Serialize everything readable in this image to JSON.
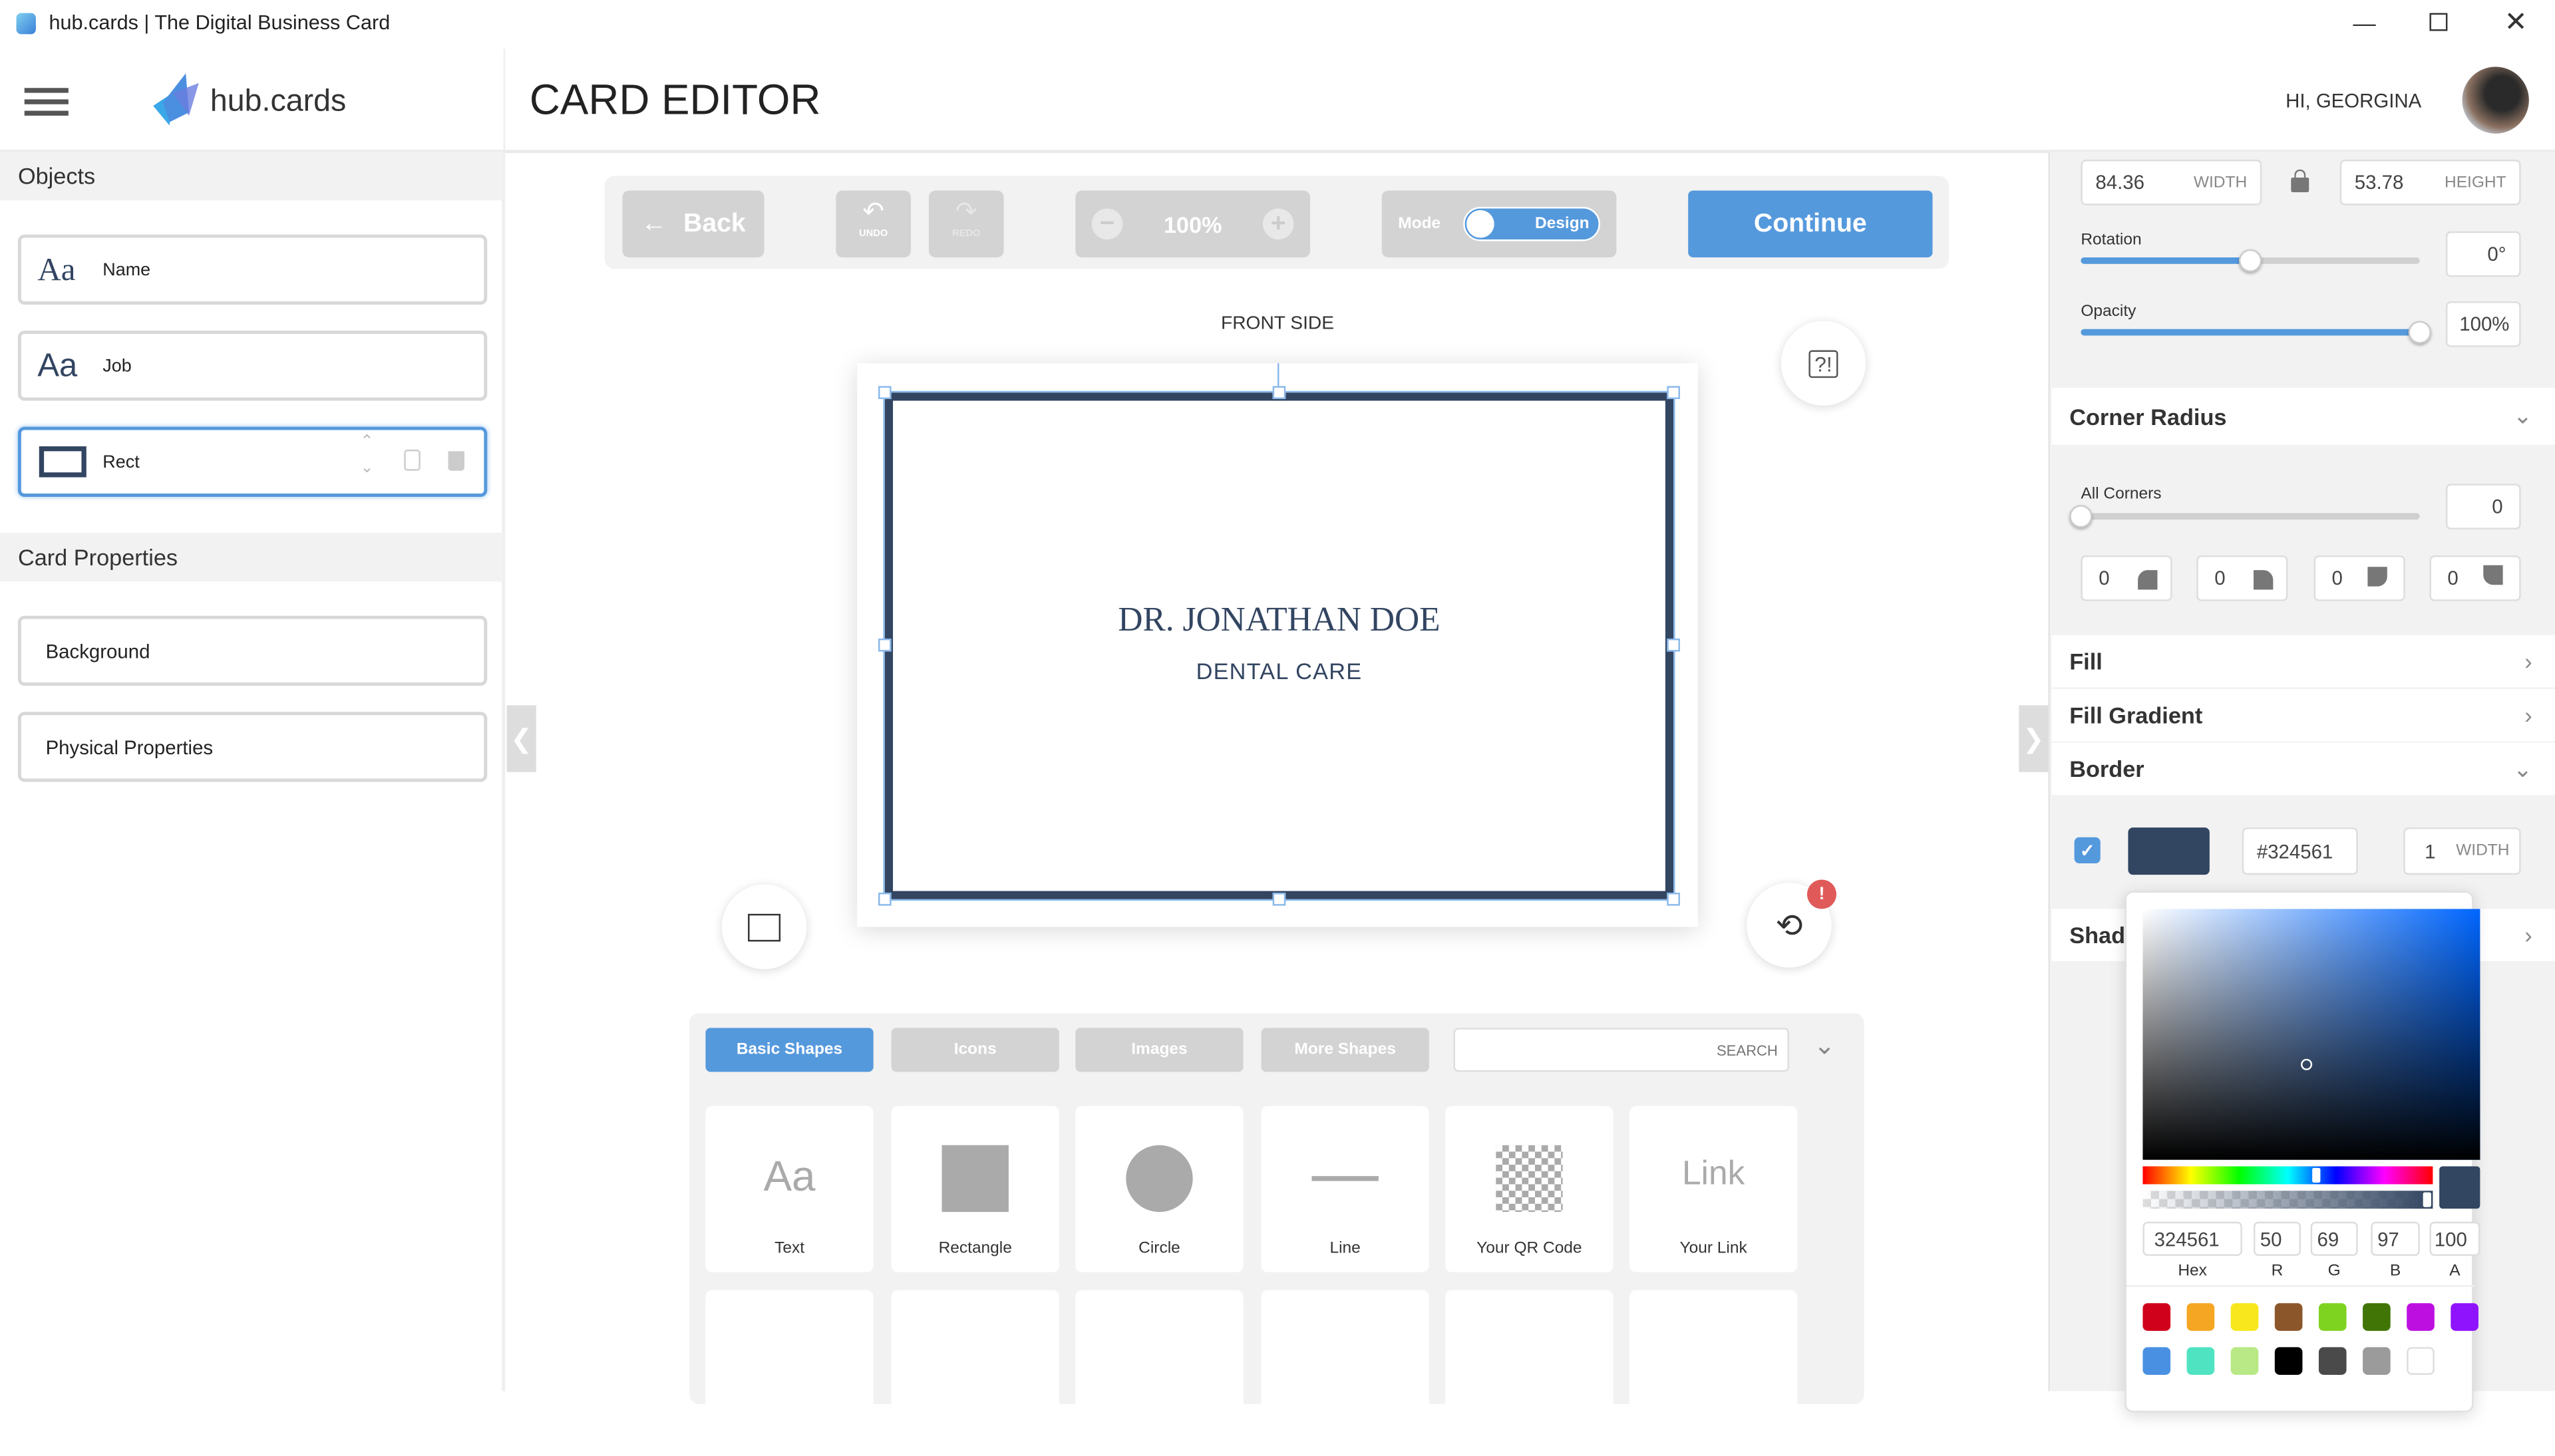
{
  "window": {
    "title": "hub.cards | The Digital Business Card"
  },
  "header": {
    "brand": "hub.cards",
    "page_title": "CARD EDITOR",
    "greeting": "HI, GEORGINA"
  },
  "left": {
    "objects_title": "Objects",
    "objects": [
      {
        "label": "Name",
        "icon": "Aa"
      },
      {
        "label": "Job",
        "icon": "Aa"
      },
      {
        "label": "Rect",
        "icon": "rect"
      }
    ],
    "card_properties_title": "Card Properties",
    "card_properties": [
      "Background",
      "Physical Properties"
    ]
  },
  "toolbar": {
    "back": "Back",
    "undo": "UNDO",
    "redo": "REDO",
    "zoom": "100%",
    "mode_label": "Mode",
    "mode_value": "Design",
    "continue": "Continue"
  },
  "canvas": {
    "side_label": "FRONT SIDE",
    "name": "DR. JONATHAN DOE",
    "job": "DENTAL CARE",
    "notification_badge": "!"
  },
  "shapes": {
    "tabs": [
      "Basic Shapes",
      "Icons",
      "Images",
      "More Shapes"
    ],
    "active_tab": "Basic Shapes",
    "search_placeholder": "SEARCH",
    "items": [
      {
        "label": "Text",
        "glyph": "Aa"
      },
      {
        "label": "Rectangle"
      },
      {
        "label": "Circle"
      },
      {
        "label": "Line"
      },
      {
        "label": "Your QR Code"
      },
      {
        "label": "Your Link",
        "glyph": "Link"
      }
    ]
  },
  "props": {
    "width": "84.36",
    "width_label": "WIDTH",
    "height": "53.78",
    "height_label": "HEIGHT",
    "rotation_label": "Rotation",
    "rotation": "0°",
    "rotation_fraction": 0.5,
    "opacity_label": "Opacity",
    "opacity": "100%",
    "opacity_fraction": 1.0,
    "corner_radius_title": "Corner Radius",
    "all_corners_label": "All Corners",
    "all_corners": "0",
    "corners": [
      "0",
      "0",
      "0",
      "0"
    ],
    "fill_title": "Fill",
    "fill_gradient_title": "Fill Gradient",
    "border_title": "Border",
    "border_enabled": true,
    "border_color": "#324561",
    "border_hex": "#324561",
    "border_width": "1",
    "border_width_label": "WIDTH",
    "shadow_title": "Shadow"
  },
  "picker": {
    "hex": "324561",
    "r": "50",
    "g": "69",
    "b": "97",
    "a": "100",
    "labels": [
      "Hex",
      "R",
      "G",
      "B",
      "A"
    ],
    "swatches": [
      "#d0021b",
      "#f5a623",
      "#f8e71c",
      "#8b572a",
      "#7ed321",
      "#417505",
      "#bd10e0",
      "#9013fe",
      "#4a90e2",
      "#50e3c2",
      "#b8e986",
      "#000000",
      "#4a4a4a",
      "#9b9b9b",
      "#ffffff"
    ]
  },
  "colors": {
    "accent": "#5599dd",
    "border": "#324561"
  }
}
